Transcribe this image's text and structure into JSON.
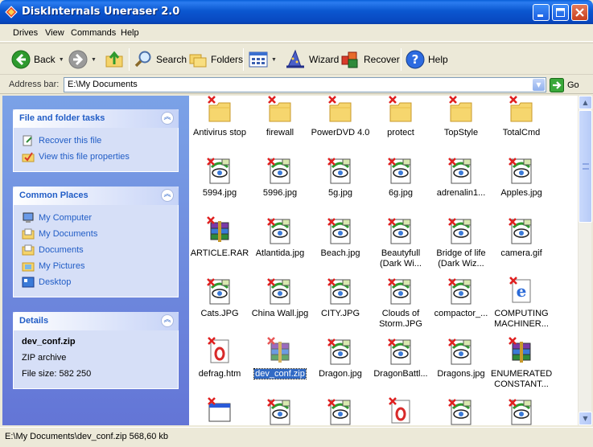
{
  "window": {
    "title": "DiskInternals Uneraser 2.0"
  },
  "menu": [
    "Drives",
    "View",
    "Commands",
    "Help"
  ],
  "toolbar": {
    "back_label": "Back",
    "search_label": "Search",
    "folders_label": "Folders",
    "wizard_label": "Wizard",
    "recover_label": "Recover",
    "help_label": "Help"
  },
  "address": {
    "label": "Address bar:",
    "value": "E:\\My Documents",
    "go_label": "Go"
  },
  "sidebar": {
    "file_tasks": {
      "title": "File and folder tasks",
      "items": [
        "Recover this file",
        "View this file properties"
      ]
    },
    "common_places": {
      "title": "Common Places",
      "items": [
        "My Computer",
        "My Documents",
        "Documents",
        "My Pictures",
        "Desktop"
      ]
    },
    "details": {
      "title": "Details",
      "file_name": "dev_conf.zip",
      "file_type": "ZIP archive",
      "file_size": "File size: 582 250"
    }
  },
  "files": [
    {
      "name": "Antivirus stop",
      "kind": "folder"
    },
    {
      "name": "firewall",
      "kind": "folder"
    },
    {
      "name": "PowerDVD 4.0",
      "kind": "folder"
    },
    {
      "name": "protect",
      "kind": "folder"
    },
    {
      "name": "TopStyle",
      "kind": "folder"
    },
    {
      "name": "TotalCmd",
      "kind": "folder"
    },
    {
      "name": "5994.jpg",
      "kind": "image"
    },
    {
      "name": "5996.jpg",
      "kind": "image"
    },
    {
      "name": "5g.jpg",
      "kind": "image"
    },
    {
      "name": "6g.jpg",
      "kind": "image"
    },
    {
      "name": "adrenalin1...",
      "kind": "image"
    },
    {
      "name": "Apples.jpg",
      "kind": "image"
    },
    {
      "name": "ARTICLE.RAR",
      "kind": "archive"
    },
    {
      "name": "Atlantida.jpg",
      "kind": "image"
    },
    {
      "name": "Beach.jpg",
      "kind": "image"
    },
    {
      "name": "Beautyfull\n(Dark Wi...",
      "kind": "image"
    },
    {
      "name": "Bridge of life\n(Dark Wiz...",
      "kind": "image"
    },
    {
      "name": "camera.gif",
      "kind": "image"
    },
    {
      "name": "Cats.JPG",
      "kind": "image"
    },
    {
      "name": "China Wall.jpg",
      "kind": "image"
    },
    {
      "name": "CITY.JPG",
      "kind": "image"
    },
    {
      "name": "Clouds of\nStorm.JPG",
      "kind": "image"
    },
    {
      "name": "compactor_...",
      "kind": "image"
    },
    {
      "name": "COMPUTING\nMACHINER...",
      "kind": "web"
    },
    {
      "name": "defrag.htm",
      "kind": "opera"
    },
    {
      "name": "dev_conf.zip",
      "kind": "archive",
      "selected": true
    },
    {
      "name": "Dragon.jpg",
      "kind": "image"
    },
    {
      "name": "DragonBattl...",
      "kind": "image"
    },
    {
      "name": "Dragons.jpg",
      "kind": "image"
    },
    {
      "name": "ENUMERATED\nCONSTANT...",
      "kind": "archive"
    },
    {
      "name": "",
      "kind": "window"
    },
    {
      "name": "",
      "kind": "image"
    },
    {
      "name": "",
      "kind": "image"
    },
    {
      "name": "",
      "kind": "opera"
    },
    {
      "name": "",
      "kind": "image"
    },
    {
      "name": "",
      "kind": "image"
    }
  ],
  "status": {
    "text": "E:\\My Documents\\dev_conf.zip 568,60 kb"
  }
}
